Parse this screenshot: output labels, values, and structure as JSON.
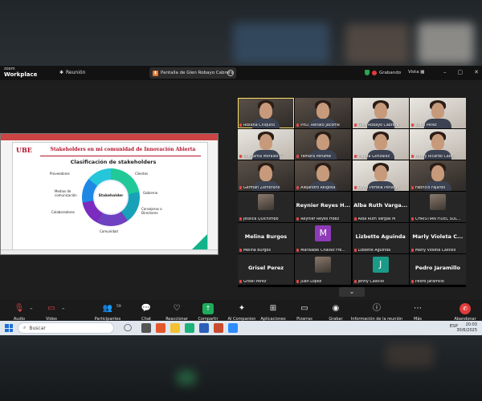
{
  "app": {
    "brand_line1": "zoom",
    "brand_line2": "Workplace",
    "meeting_label": "Reunión"
  },
  "share_tab": {
    "label": "Pantalla de Glen Robayo Cabrera"
  },
  "status": {
    "recording": "Grabando",
    "view": "Vista"
  },
  "slide": {
    "logo": "UBE",
    "title": "Stakeholders en mi comunidad de Innovación Abierta",
    "subtitle": "Clasificación de stakeholders",
    "center": "Stakeholder",
    "labels": [
      "Proveedores",
      "Clientes",
      "Gobierno",
      "Consejeros o Directores",
      "Comunidad",
      "Colaboradores",
      "Medios de comunicación"
    ]
  },
  "participants": [
    {
      "name": "Roxana Chiquito",
      "kind": "video",
      "active": true
    },
    {
      "name": "PhD. Renato Jácome",
      "kind": "video"
    },
    {
      "name": "Glen Robayo Cabrera",
      "kind": "vlight"
    },
    {
      "name": "Karla Pérez",
      "kind": "vlight"
    },
    {
      "name": "Margarita Morales C",
      "kind": "vlight"
    },
    {
      "name": "Yamara Peñafiel",
      "kind": "video"
    },
    {
      "name": "Mayda González",
      "kind": "vlight"
    },
    {
      "name": "Henry Ricardo Cabr...",
      "kind": "vlight"
    },
    {
      "name": "German Zambrano",
      "kind": "video"
    },
    {
      "name": "Alejandro Reigosa",
      "kind": "video"
    },
    {
      "name": "Leyni Portela Peñafiel",
      "kind": "vlight"
    },
    {
      "name": "Fabricio Fajardo",
      "kind": "video"
    },
    {
      "name": "Jessica Quichimbo",
      "kind": "pic"
    },
    {
      "name": "Reynier Reyes Hdez",
      "kind": "big",
      "big": "Reynier Reyes H..."
    },
    {
      "name": "Alba Ruth Vargas M",
      "kind": "big",
      "big": "Alba Ruth Varga..."
    },
    {
      "name": "CHRISTIAN FIDEL SOL...",
      "kind": "pic"
    },
    {
      "name": "Melina Burgos",
      "kind": "big",
      "big": "Melina Burgos"
    },
    {
      "name": "Marisabel Chávez Fre...",
      "kind": "avatar",
      "letter": "M",
      "color": "#8e3bb8"
    },
    {
      "name": "Lizbette Aguinda",
      "kind": "big",
      "big": "Lizbette Aguinda"
    },
    {
      "name": "Marly Violeta Castillo",
      "kind": "big",
      "big": "Marly Violeta C..."
    },
    {
      "name": "Grisel Perez",
      "kind": "big",
      "big": "Grisel Perez"
    },
    {
      "name": "Juan López",
      "kind": "pic"
    },
    {
      "name": "Jenny Castillo",
      "kind": "avatar",
      "letter": "J",
      "color": "#1c9a88"
    },
    {
      "name": "Pedro Jaramillo",
      "kind": "big",
      "big": "Pedro Jaramillo"
    }
  ],
  "toolbar": {
    "audio": "Audio",
    "video": "Video",
    "participants": "Participantes",
    "participants_count": "59",
    "chat": "Chat",
    "react": "Reaccionar",
    "share": "Compartir",
    "ai": "AI Companion",
    "apps": "Aplicaciones",
    "whiteboards": "Pizarras",
    "record": "Grabar",
    "info": "Información de la reunión",
    "more": "Más",
    "leave": "Abandonar"
  },
  "taskbar": {
    "search": "Buscar",
    "lang": "ESP",
    "time": "20:03",
    "date": "30/6/2025"
  }
}
